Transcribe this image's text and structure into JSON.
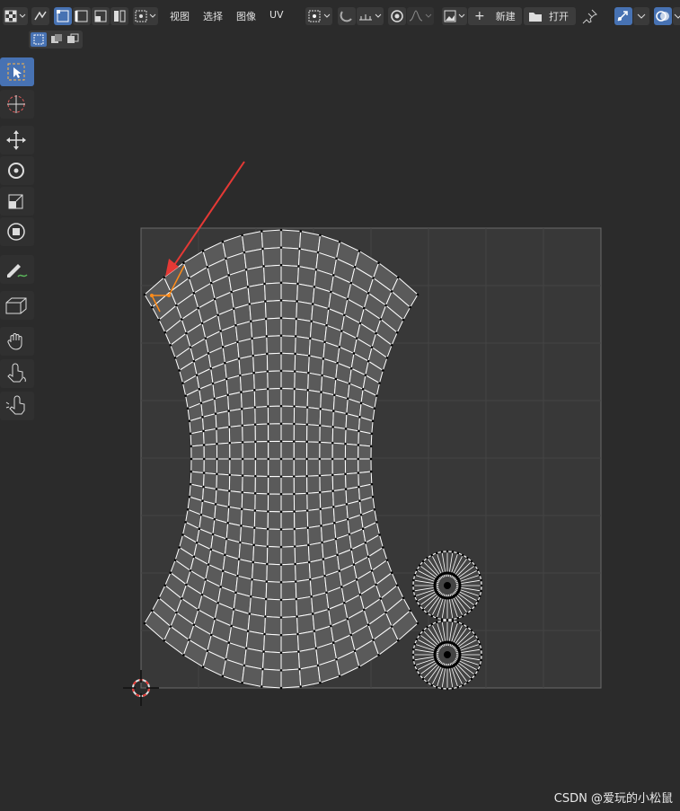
{
  "header": {
    "menus": [
      "视图",
      "选择",
      "图像",
      "UV"
    ],
    "new_label": "新建",
    "open_label": "打开"
  },
  "toolbar": {
    "tools": [
      "select-box",
      "cursor",
      "move",
      "rotate",
      "scale",
      "transform",
      "annotate",
      "rip-region",
      "grab",
      "relax",
      "pinch"
    ]
  },
  "colors": {
    "accent": "#4772b3",
    "selected_edge": "#ff8c1a",
    "annotation_arrow": "#e53935",
    "mesh_fill": "#5a5a5a",
    "mesh_edge": "#ffffff"
  },
  "watermark": "CSDN @爱玩的小松鼠"
}
